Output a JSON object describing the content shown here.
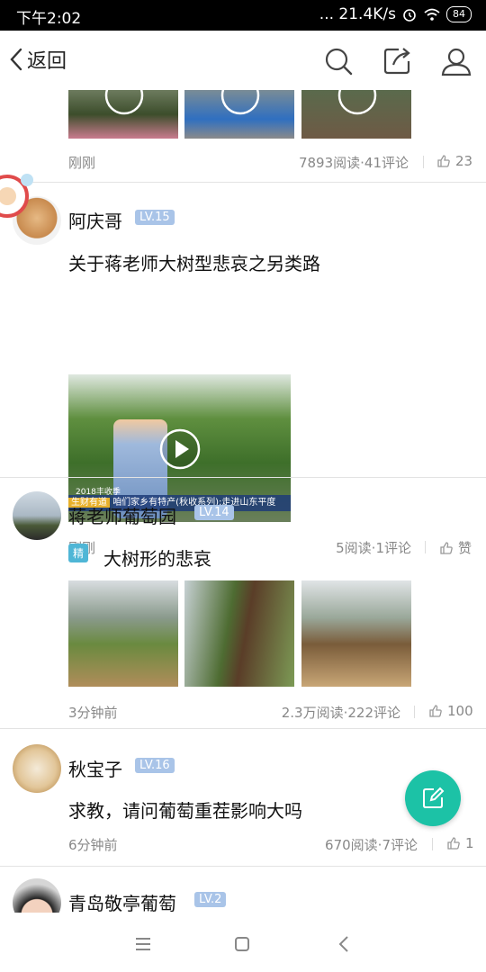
{
  "status_bar": {
    "time": "下午2:02",
    "network": "... 21.4K/s",
    "battery": "84"
  },
  "nav": {
    "back_label": "返回"
  },
  "posts": [
    {
      "time": "刚刚",
      "stats": "7893阅读·41评论",
      "likes": "23"
    },
    {
      "user": "阿庆哥",
      "level": "LV.15",
      "title": "关于蒋老师大树型悲哀之另类路",
      "video_caption": "咱们家乡有特产(秋收系列):走进山东平度",
      "video_tag": "生财有道",
      "video_year": "2018丰收季",
      "time": "刚刚",
      "stats": "5阅读·1评论",
      "likes": "赞"
    },
    {
      "user": "蒋老师葡萄园",
      "level": "LV.14",
      "badge": "精",
      "title": "大树形的悲哀",
      "time": "3分钟前",
      "stats": "2.3万阅读·222评论",
      "likes": "100"
    },
    {
      "user": "秋宝子",
      "level": "LV.16",
      "title": "求教，请问葡萄重茬影响大吗",
      "time": "6分钟前",
      "stats": "670阅读·7评论",
      "likes": "1"
    },
    {
      "user": "青岛敬亭葡萄",
      "level": "LV.2"
    }
  ],
  "colors": {
    "accent": "#1cc2a6",
    "level_badge": "#a9c4e8",
    "badge": "#4fb6d6"
  },
  "icons": [
    "search-icon",
    "share-icon",
    "user-icon",
    "play-icon",
    "thumbs-up-icon",
    "edit-icon",
    "menu-icon",
    "home-icon",
    "back-icon"
  ]
}
